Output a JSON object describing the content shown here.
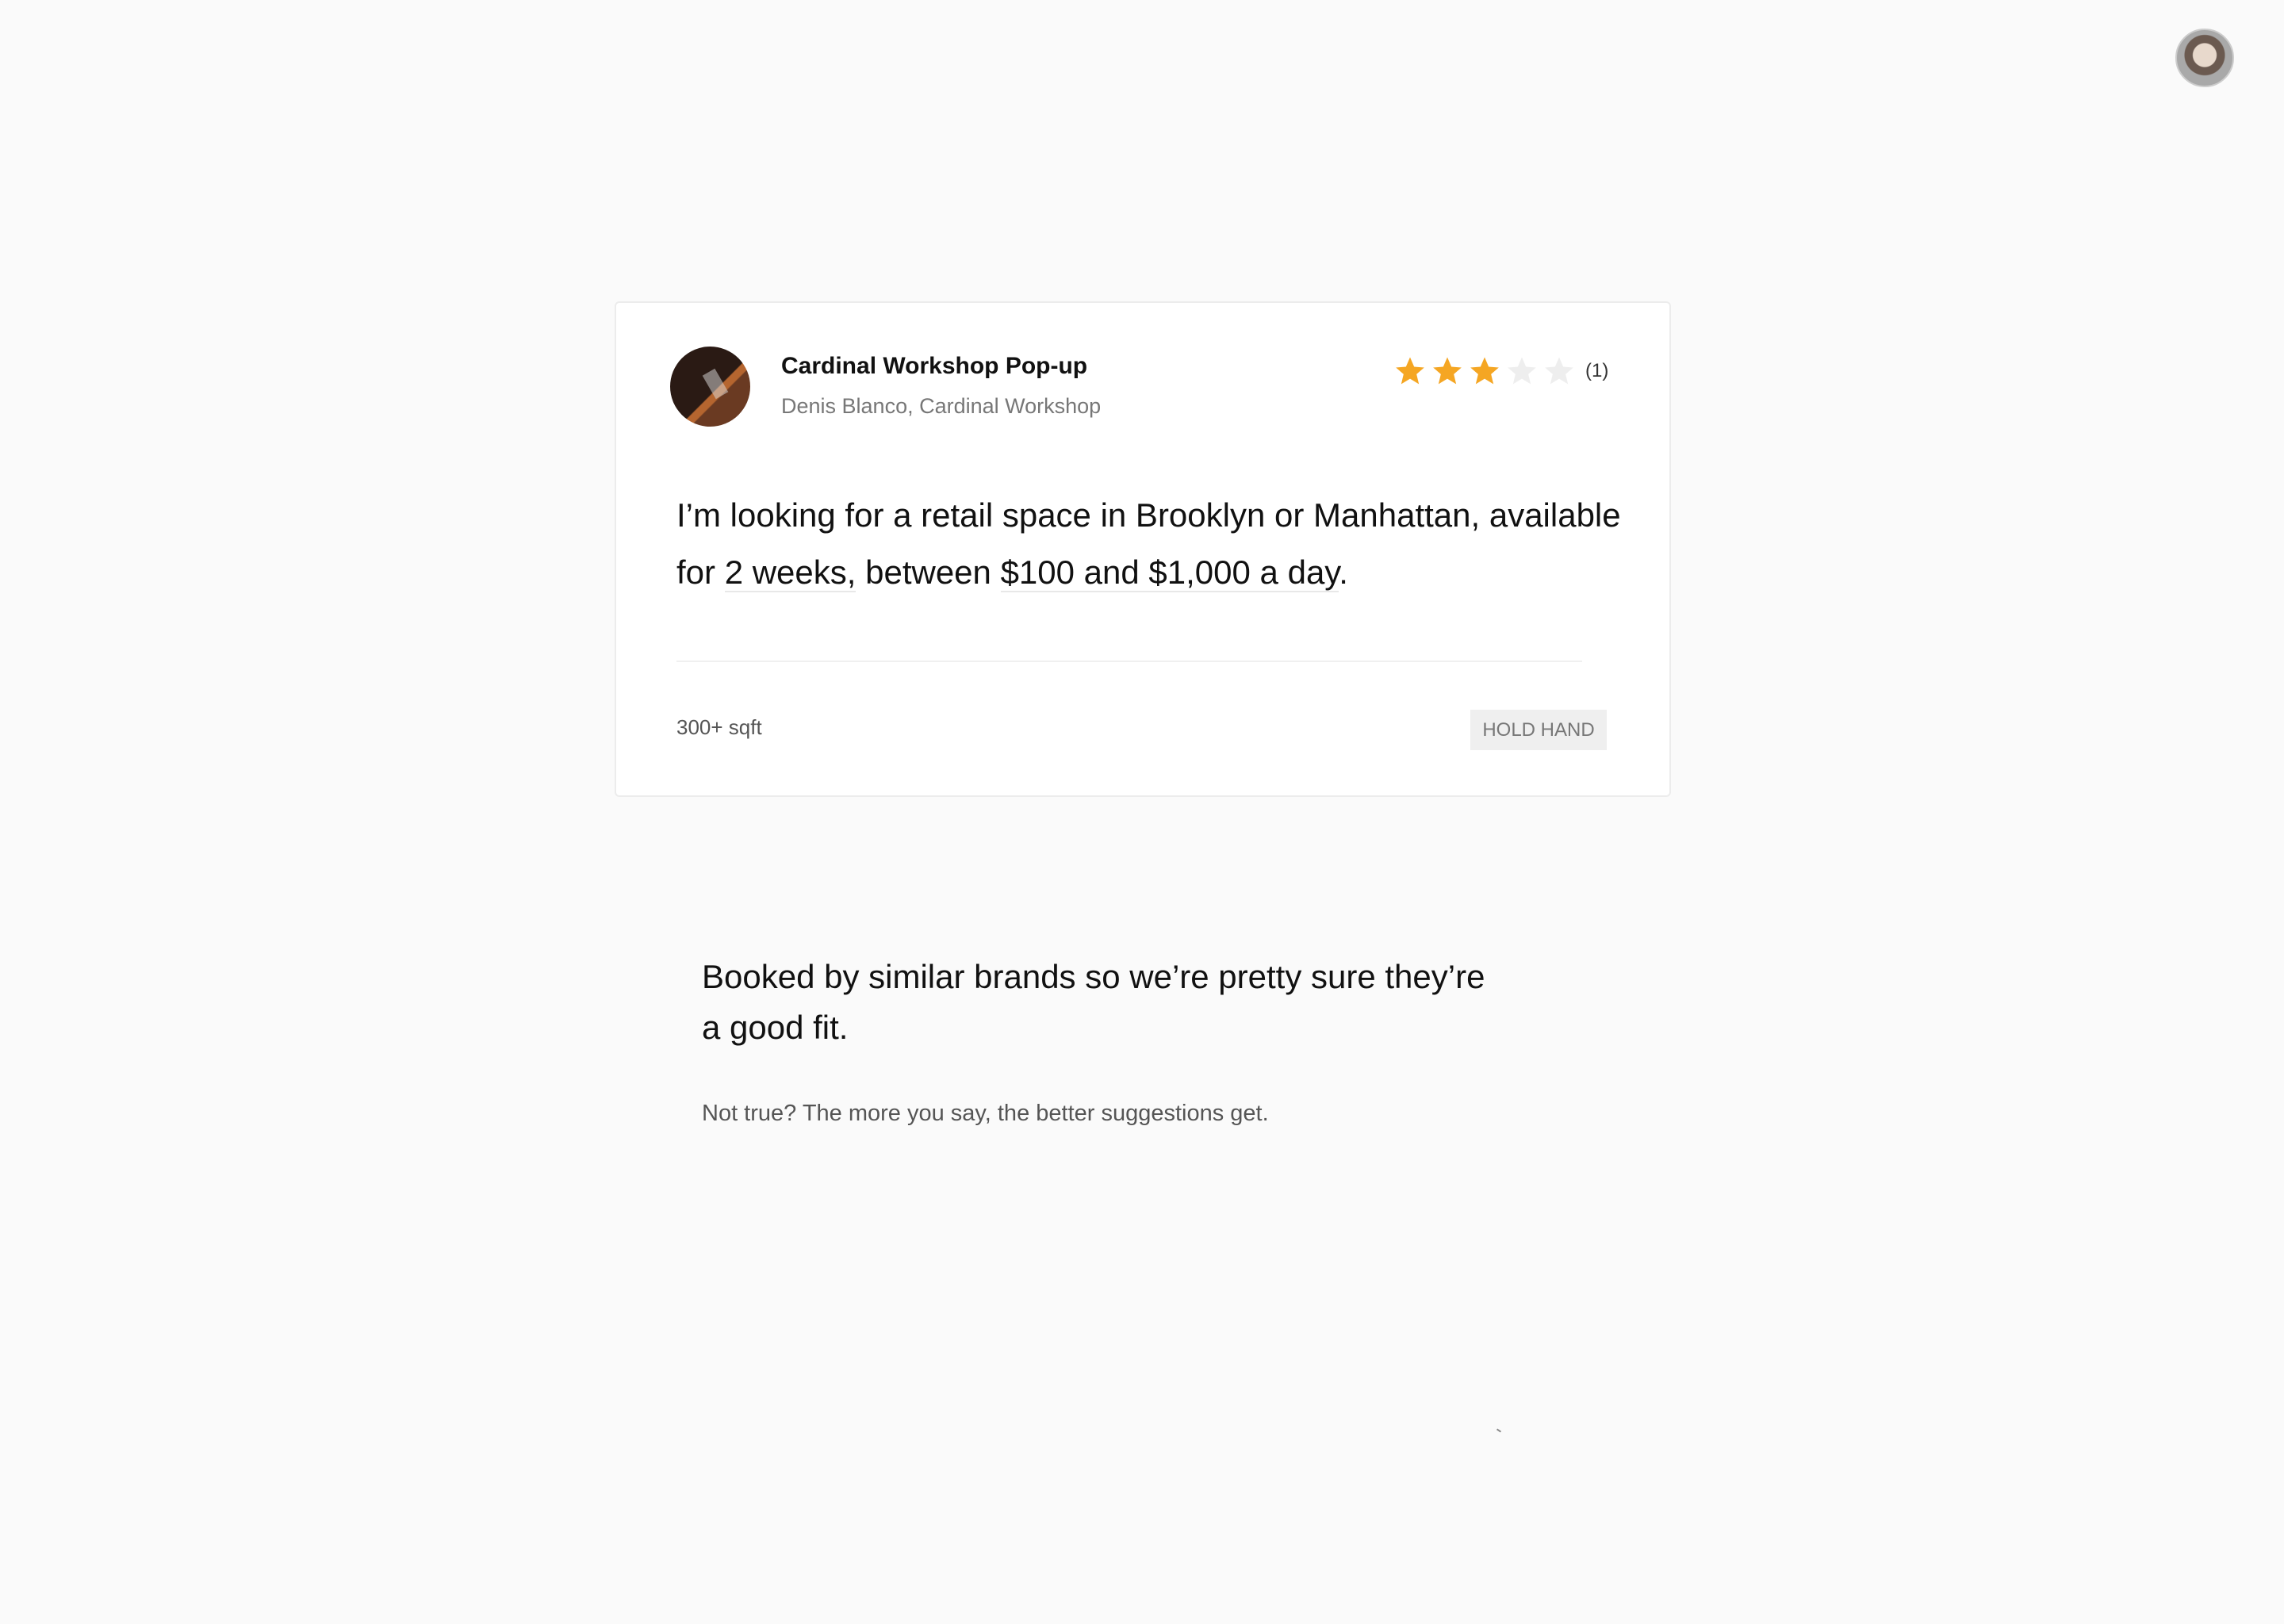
{
  "header": {
    "user_avatar_icon": "user-avatar-photo"
  },
  "listing": {
    "title": "Cardinal Workshop Pop-up",
    "subtitle": "Denis Blanco, Cardinal Workshop",
    "rating": 3,
    "rating_max": 5,
    "rating_count": "(1)",
    "star_color": "#f5a623",
    "star_empty_color": "#eeeeee",
    "request": {
      "part1": "I’m looking for a retail space in Brooklyn or Manhattan, available for ",
      "duration": "2 weeks,",
      "part2": " between ",
      "budget": "$100 and $1,000 a day",
      "part3": "."
    },
    "size": "300+ sqft",
    "action_label": "HOLD HAND"
  },
  "suggestion": {
    "heading": "Booked by similar brands so we’re pretty sure they’re a good fit.",
    "note": "Not true?  The more you say, the better suggestions get."
  }
}
